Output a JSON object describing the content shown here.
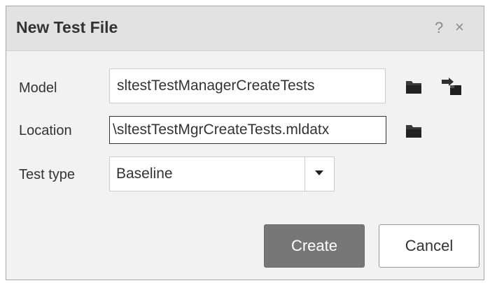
{
  "dialog": {
    "title": "New Test File",
    "help_glyph": "?",
    "close_glyph": "×",
    "icons": {
      "help": "help-icon",
      "close": "close-icon",
      "browse": "folder-icon",
      "use_current": "use-current-model-icon"
    }
  },
  "form": {
    "model": {
      "label": "Model",
      "value": "sltestTestManagerCreateTests"
    },
    "location": {
      "label": "Location",
      "value": "\\sltestTestMgrCreateTests.mldatx"
    },
    "test_type": {
      "label": "Test type",
      "selected": "Baseline"
    }
  },
  "buttons": {
    "create_label": "Create",
    "cancel_label": "Cancel"
  },
  "colors": {
    "primary_button": "#777777",
    "title_bar": "#e2e2e2",
    "dialog_bg": "#f2f2f2"
  }
}
